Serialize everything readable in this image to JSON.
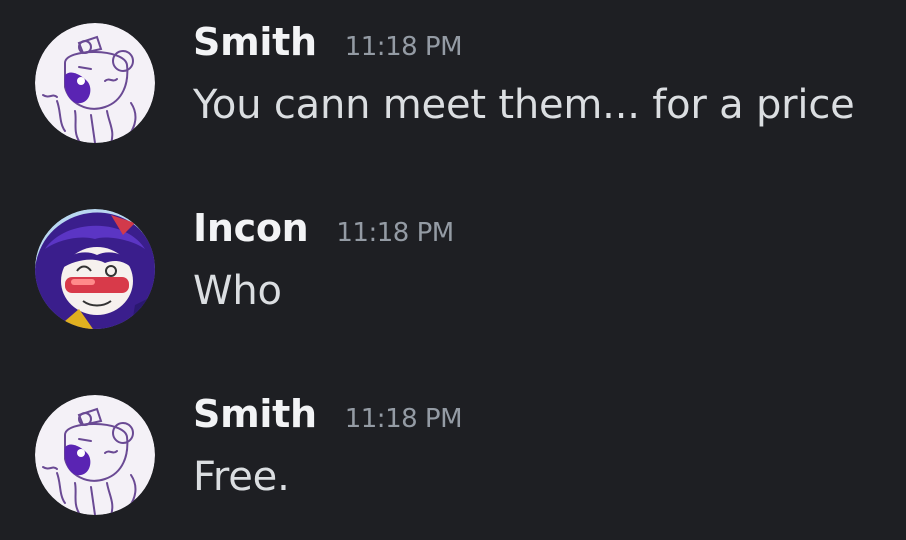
{
  "messages": [
    {
      "author": "Smith",
      "time": "11:18 PM",
      "text": "You cann meet them... for a price",
      "avatar_icon": "purple-guy-sketch-avatar"
    },
    {
      "author": "Incon",
      "time": "11:18 PM",
      "text": "Who",
      "avatar_icon": "purple-hair-girl-avatar"
    },
    {
      "author": "Smith",
      "time": "11:18 PM",
      "text": "Free.",
      "avatar_icon": "purple-guy-sketch-avatar"
    }
  ],
  "colors": {
    "background": "#1e1f23",
    "username": "#f2f3f5",
    "timestamp": "#949ba4",
    "message_text": "#dbdee1"
  }
}
